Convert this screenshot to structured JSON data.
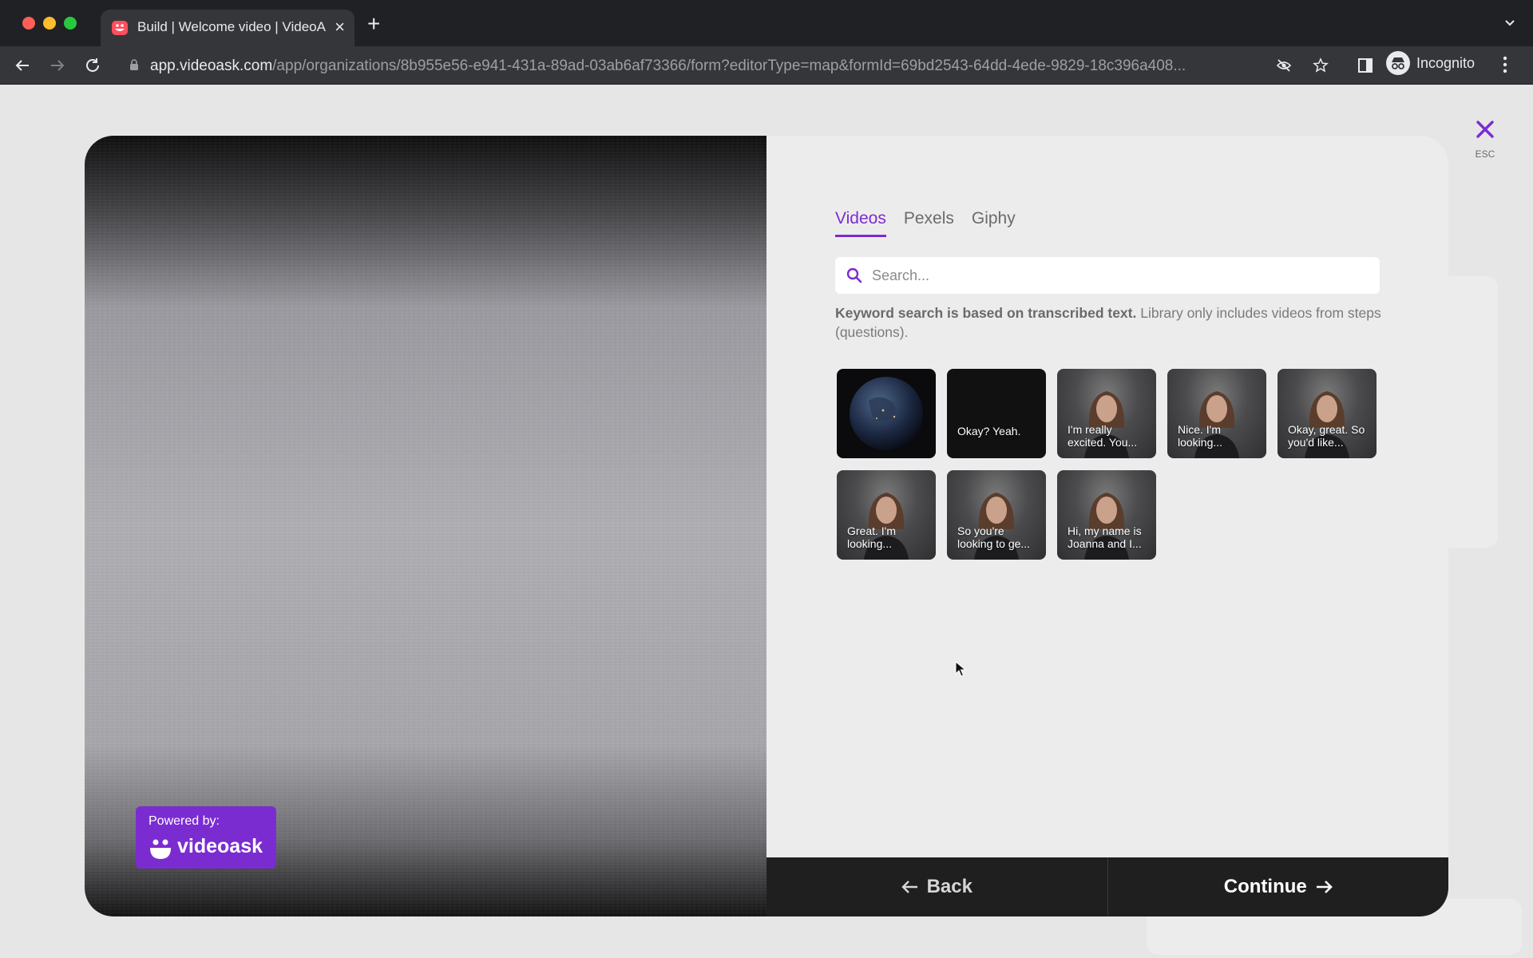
{
  "browser": {
    "tab_title": "Build | Welcome video | VideoA",
    "url_host": "app.videoask.com",
    "url_path": "/app/organizations/8b955e56-e941-431a-89ad-03ab6af73366/form?editorType=map&formId=69bd2543-64dd-4ede-9829-18c396a408...",
    "profile_label": "Incognito"
  },
  "media_picker": {
    "tabs": [
      {
        "label": "Videos",
        "active": true
      },
      {
        "label": "Pexels",
        "active": false
      },
      {
        "label": "Giphy",
        "active": false
      }
    ],
    "search_placeholder": "Search...",
    "hint_bold": "Keyword search is based on transcribed text.",
    "hint_rest": " Library only includes videos from steps (questions).",
    "videos": [
      {
        "caption": "",
        "kind": "earth"
      },
      {
        "caption": "Okay? Yeah.",
        "kind": "dark"
      },
      {
        "caption": "I'm really excited. You...",
        "kind": "person"
      },
      {
        "caption": "Nice. I'm looking...",
        "kind": "person"
      },
      {
        "caption": "Okay, great. So you'd like...",
        "kind": "person"
      },
      {
        "caption": "Great. I'm looking...",
        "kind": "person"
      },
      {
        "caption": "So you're looking to ge...",
        "kind": "person"
      },
      {
        "caption": "Hi, my name is Joanna and I...",
        "kind": "person"
      }
    ]
  },
  "branding": {
    "powered_by": "Powered by:",
    "brand": "videoask"
  },
  "footer": {
    "back_label": "Back",
    "continue_label": "Continue"
  },
  "close": {
    "esc_label": "ESC"
  },
  "colors": {
    "accent": "#7b2cd1",
    "footer_bg": "#1f1f20"
  }
}
